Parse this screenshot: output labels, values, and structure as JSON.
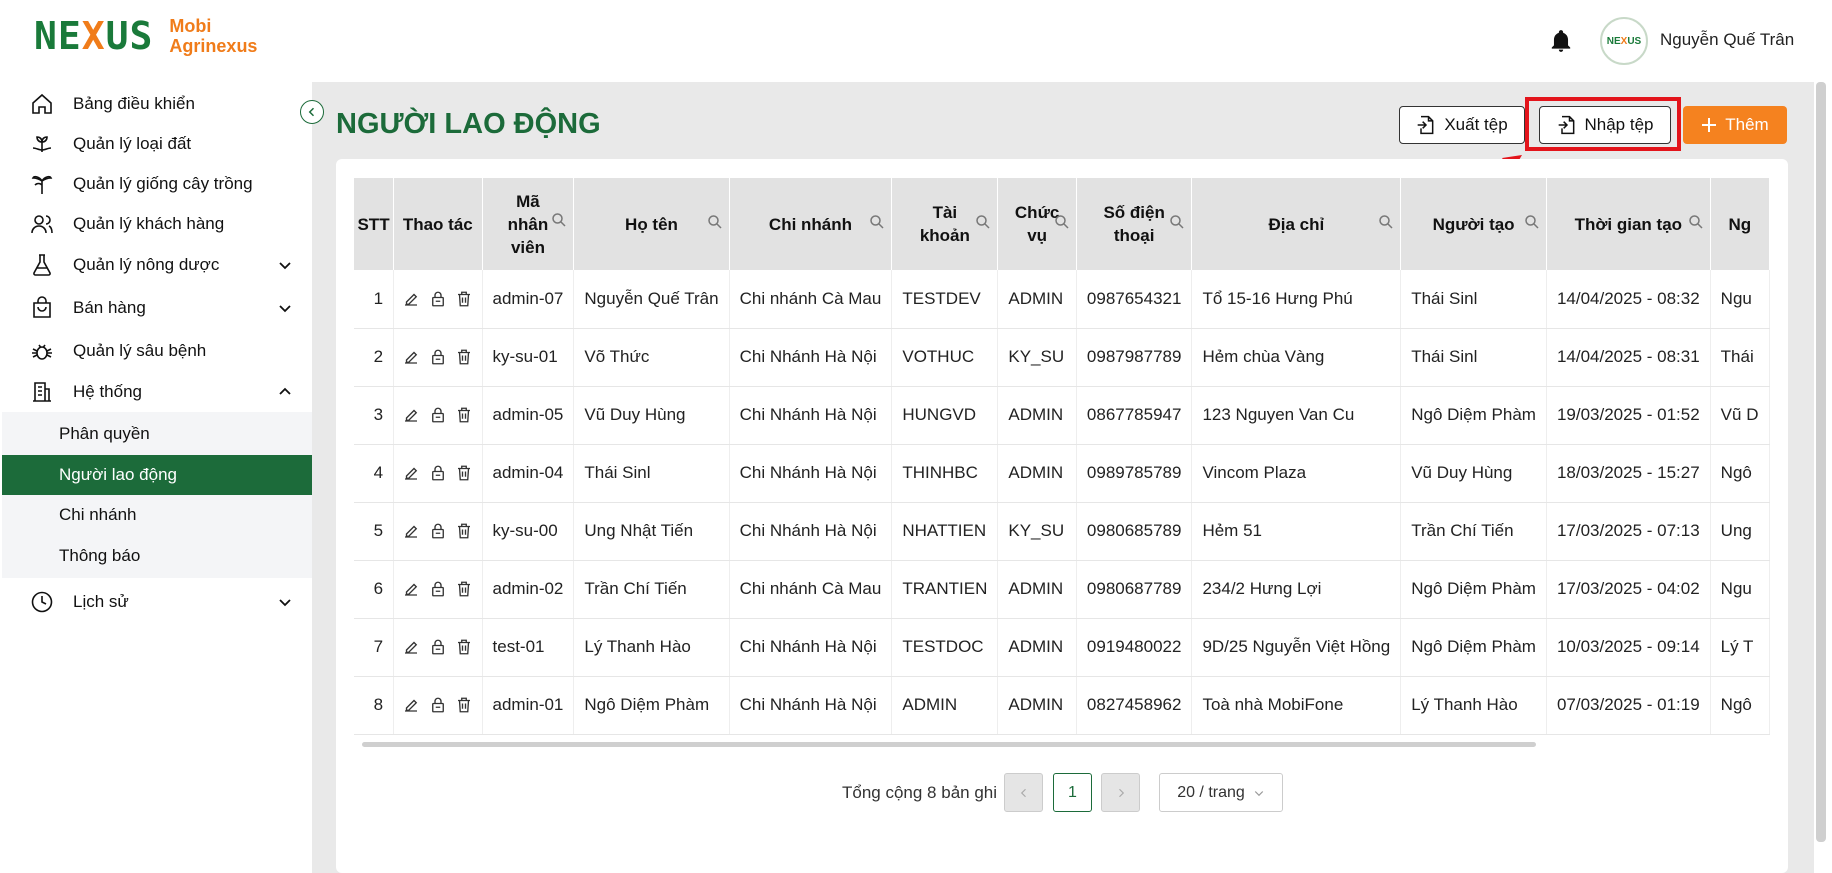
{
  "brand": {
    "mark_a": "NE",
    "mark_x": "X",
    "mark_b": "US",
    "line1": "Mobi",
    "line2": "Agrinexus"
  },
  "user": {
    "name": "Nguyễn Quế Trân"
  },
  "sidebar": {
    "items": [
      {
        "label": "Bảng điều khiển",
        "icon": "home-icon"
      },
      {
        "label": "Quản lý loại đất",
        "icon": "soil-icon"
      },
      {
        "label": "Quản lý giống cây trồng",
        "icon": "plant-icon"
      },
      {
        "label": "Quản lý khách hàng",
        "icon": "users-icon"
      },
      {
        "label": "Quản lý nông dược",
        "icon": "flask-icon",
        "expandable": true
      },
      {
        "label": "Bán hàng",
        "icon": "bag-icon",
        "expandable": true
      },
      {
        "label": "Quản lý sâu bệnh",
        "icon": "bug-icon"
      },
      {
        "label": "Hệ thống",
        "icon": "building-icon",
        "expanded": true
      },
      {
        "label": "Lịch sử",
        "icon": "clock-icon",
        "expandable": true
      }
    ],
    "subitems": [
      {
        "label": "Phân quyền"
      },
      {
        "label": "Người lao động",
        "active": true
      },
      {
        "label": "Chi nhánh"
      },
      {
        "label": "Thông báo"
      }
    ]
  },
  "page": {
    "title": "NGƯỜI LAO ĐỘNG"
  },
  "toolbar": {
    "export_label": "Xuất tệp",
    "import_label": "Nhập tệp",
    "add_label": "Thêm"
  },
  "colors": {
    "primary": "#1c6b3a",
    "accent": "#f5821f",
    "highlight": "#e3141b"
  },
  "table": {
    "headers": {
      "stt": "STT",
      "actions": "Thao tác",
      "code_1": "Mã",
      "code_2": "nhân",
      "code_3": "viên",
      "name": "Họ tên",
      "branch": "Chi nhánh",
      "account_1": "Tài",
      "account_2": "khoản",
      "role_1": "Chức",
      "role_2": "vụ",
      "phone_1": "Số điện",
      "phone_2": "thoại",
      "address": "Địa chỉ",
      "creator": "Người tạo",
      "created": "Thời gian tạo",
      "updater": "Ng"
    },
    "rows": [
      [
        "1",
        "admin-07",
        "Nguyễn Quế Trân",
        "Chi nhánh Cà Mau",
        "TESTDEV",
        "ADMIN",
        "0987654321",
        "Tổ 15-16 Hưng Phú",
        "Thái Sinl",
        "14/04/2025 - 08:32",
        "Ngu"
      ],
      [
        "2",
        "ky-su-01",
        "Võ Thức",
        "Chi Nhánh Hà Nội",
        "VOTHUC",
        "KY_SU",
        "0987987789",
        "Hẻm chùa Vàng",
        "Thái Sinl",
        "14/04/2025 - 08:31",
        "Thái"
      ],
      [
        "3",
        "admin-05",
        "Vũ Duy Hùng",
        "Chi Nhánh Hà Nội",
        "HUNGVD",
        "ADMIN",
        "0867785947",
        "123 Nguyen Van Cu",
        "Ngô Diệm Phàm",
        "19/03/2025 - 01:52",
        "Vũ D"
      ],
      [
        "4",
        "admin-04",
        "Thái Sinl",
        "Chi Nhánh Hà Nội",
        "THINHBC",
        "ADMIN",
        "0989785789",
        "Vincom Plaza",
        "Vũ Duy Hùng",
        "18/03/2025 - 15:27",
        "Ngô"
      ],
      [
        "5",
        "ky-su-00",
        "Ung Nhật Tiến",
        "Chi Nhánh Hà Nội",
        "NHATTIEN",
        "KY_SU",
        "0980685789",
        "Hẻm 51",
        "Trần Chí Tiến",
        "17/03/2025 - 07:13",
        "Ung"
      ],
      [
        "6",
        "admin-02",
        "Trần Chí Tiến",
        "Chi nhánh Cà Mau",
        "TRANTIEN",
        "ADMIN",
        "0980687789",
        "234/2 Hưng Lợi",
        "Ngô Diệm Phàm",
        "17/03/2025 - 04:02",
        "Ngu"
      ],
      [
        "7",
        "test-01",
        "Lý Thanh Hào",
        "Chi Nhánh Hà Nội",
        "TESTDOC",
        "ADMIN",
        "0919480022",
        "9D/25 Nguyễn Việt Hồng",
        "Ngô Diệm Phàm",
        "10/03/2025 - 09:14",
        "Lý T"
      ],
      [
        "8",
        "admin-01",
        "Ngô Diệm Phàm",
        "Chi Nhánh Hà Nội",
        "ADMIN",
        "ADMIN",
        "0827458962",
        "Toà nhà MobiFone",
        "Lý Thanh Hào",
        "07/03/2025 - 01:19",
        "Ngô"
      ]
    ]
  },
  "pagination": {
    "total_text": "Tổng cộng 8 bản ghi",
    "current_page": "1",
    "page_size": "20 / trang",
    "prev": "<",
    "next": ">"
  }
}
